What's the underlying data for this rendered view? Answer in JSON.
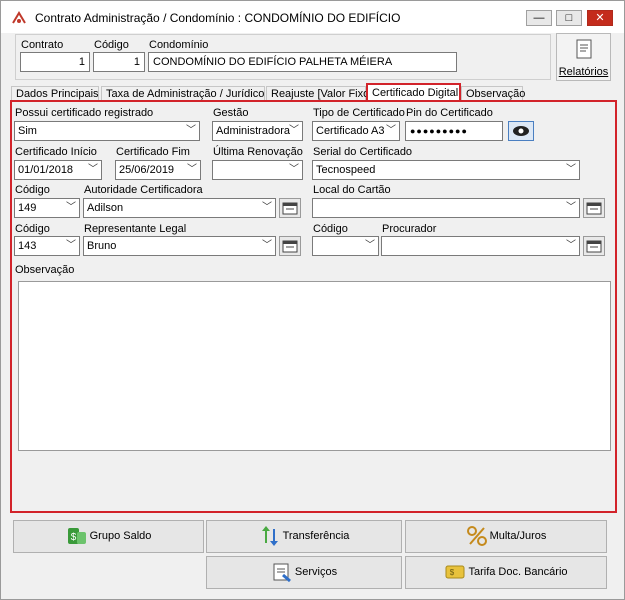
{
  "window": {
    "title": "Contrato Administração / Condomínio : CONDOMÍNIO DO EDIFÍCIO",
    "minimize": "—",
    "maximize": "□",
    "close": "✕"
  },
  "header": {
    "contrato_label": "Contrato",
    "contrato_value": "1",
    "codigo_label": "Código",
    "codigo_value": "1",
    "condominio_label": "Condomínio",
    "condominio_value": "CONDOMÍNIO DO EDIFÍCIO PALHETA MÉIERA",
    "relatorios_label": "Relatórios"
  },
  "tabs": [
    "Dados Principais",
    "Taxa de Administração / Jurídico",
    "Reajuste [Valor Fixo]",
    "Certificado Digital",
    "Observação"
  ],
  "form": {
    "possui_label": "Possui certificado registrado",
    "possui_value": "Sim",
    "gestao_label": "Gestão",
    "gestao_value": "Administradora",
    "tipo_label": "Tipo de Certificado",
    "tipo_value": "Certificado A3",
    "pin_label": "Pin do Certificado",
    "pin_value": "●●●●●●●●●",
    "inicio_label": "Certificado Início",
    "inicio_value": "01/01/2018",
    "fim_label": "Certificado Fim",
    "fim_value": "25/06/2019",
    "renovacao_label": "Última Renovação",
    "renovacao_value": "",
    "serial_label": "Serial do Certificado",
    "serial_value": "Tecnospeed",
    "codigo1_label": "Código",
    "codigo1_value": "149",
    "autoridade_label": "Autoridade Certificadora",
    "autoridade_value": "Adilson",
    "local_label": "Local do Cartão",
    "local_value": "",
    "codigo2_label": "Código",
    "codigo2_value": "143",
    "representante_label": "Representante Legal",
    "representante_value": "Bruno",
    "codigo3_label": "Código",
    "codigo3_value": "",
    "procurador_label": "Procurador",
    "procurador_value": "",
    "observacao_label": "Observação",
    "observacao_value": ""
  },
  "buttons": {
    "grupo_saldo": "Grupo Saldo",
    "transferencia": "Transferência",
    "multa_juros": "Multa/Juros",
    "servicos": "Serviços",
    "tarifa": "Tarifa Doc. Bancário"
  }
}
